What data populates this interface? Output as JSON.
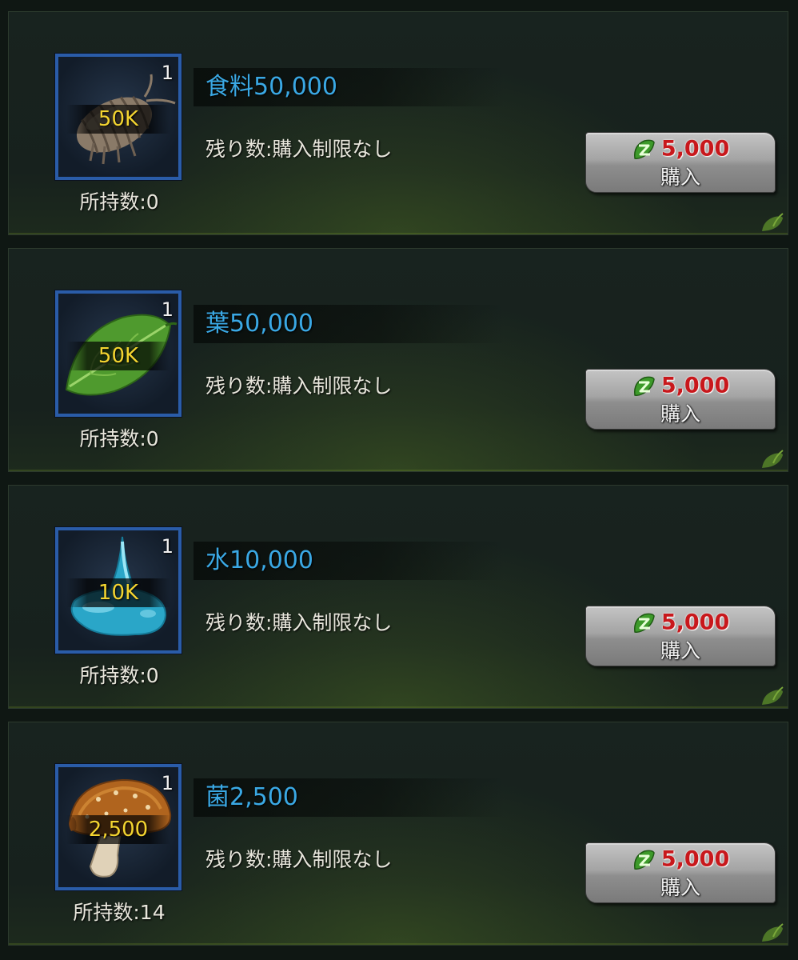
{
  "items": [
    {
      "name": "食料50,000",
      "remaining": "残り数:購入制限なし",
      "owned": "所持数:0",
      "stack": "1",
      "amount": "50K",
      "icon": "pillbug-icon",
      "price": "5,000",
      "buy_label": "購入"
    },
    {
      "name": "葉50,000",
      "remaining": "残り数:購入制限なし",
      "owned": "所持数:0",
      "stack": "1",
      "amount": "50K",
      "icon": "leaf-icon",
      "price": "5,000",
      "buy_label": "購入"
    },
    {
      "name": "水10,000",
      "remaining": "残り数:購入制限なし",
      "owned": "所持数:0",
      "stack": "1",
      "amount": "10K",
      "icon": "water-drop-icon",
      "price": "5,000",
      "buy_label": "購入"
    },
    {
      "name": "菌2,500",
      "remaining": "残り数:購入制限なし",
      "owned": "所持数:14",
      "stack": "1",
      "amount": "2,500",
      "icon": "mushroom-icon",
      "price": "5,000",
      "buy_label": "購入"
    }
  ],
  "currency_icon": "green-leaf-currency-icon",
  "colors": {
    "item_name": "#3aa8e4",
    "price": "#c8181c",
    "amount": "#f3d430",
    "icon_border": "#2a5ca8"
  }
}
